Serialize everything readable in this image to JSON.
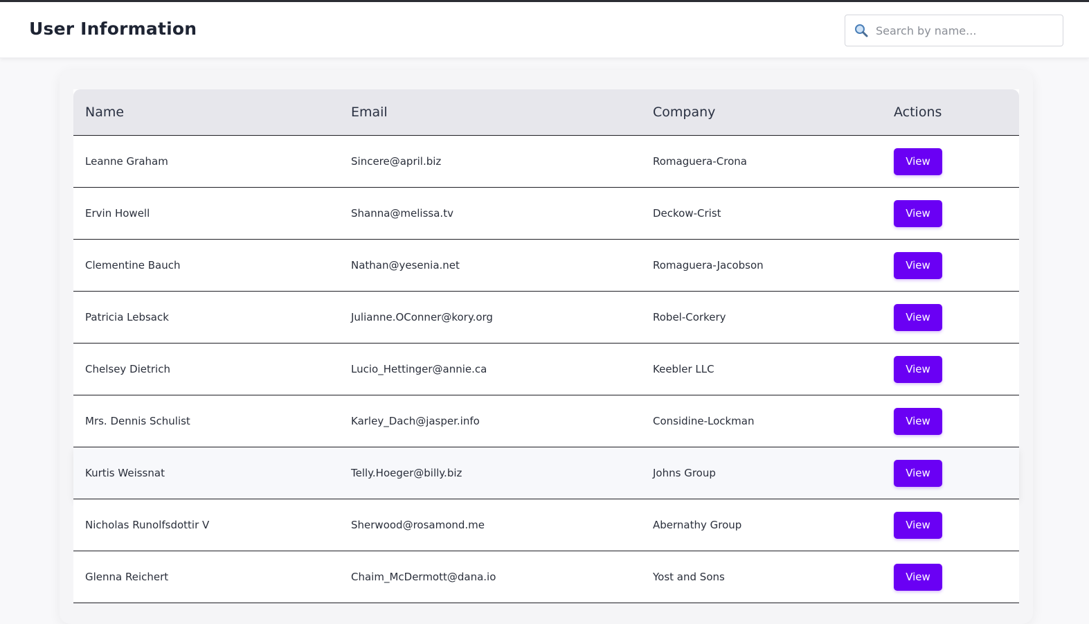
{
  "header": {
    "title": "User Information",
    "search_placeholder": "Search by name...",
    "search_value": ""
  },
  "table": {
    "columns": [
      "Name",
      "Email",
      "Company",
      "Actions"
    ],
    "rows": [
      {
        "name": "Leanne Graham",
        "email": "Sincere@april.biz",
        "company": "Romaguera-Crona",
        "action": "View"
      },
      {
        "name": "Ervin Howell",
        "email": "Shanna@melissa.tv",
        "company": "Deckow-Crist",
        "action": "View"
      },
      {
        "name": "Clementine Bauch",
        "email": "Nathan@yesenia.net",
        "company": "Romaguera-Jacobson",
        "action": "View"
      },
      {
        "name": "Patricia Lebsack",
        "email": "Julianne.OConner@kory.org",
        "company": "Robel-Corkery",
        "action": "View"
      },
      {
        "name": "Chelsey Dietrich",
        "email": "Lucio_Hettinger@annie.ca",
        "company": "Keebler LLC",
        "action": "View"
      },
      {
        "name": "Mrs. Dennis Schulist",
        "email": "Karley_Dach@jasper.info",
        "company": "Considine-Lockman",
        "action": "View"
      },
      {
        "name": "Kurtis Weissnat",
        "email": "Telly.Hoeger@billy.biz",
        "company": "Johns Group",
        "action": "View"
      },
      {
        "name": "Nicholas Runolfsdottir V",
        "email": "Sherwood@rosamond.me",
        "company": "Abernathy Group",
        "action": "View"
      },
      {
        "name": "Glenna Reichert",
        "email": "Chaim_McDermott@dana.io",
        "company": "Yost and Sons",
        "action": "View"
      }
    ]
  },
  "colors": {
    "accent": "#6a00f4",
    "header_bg": "#e7e7ec",
    "title_text": "#1e2433"
  },
  "icons": {
    "search": "search-icon"
  }
}
